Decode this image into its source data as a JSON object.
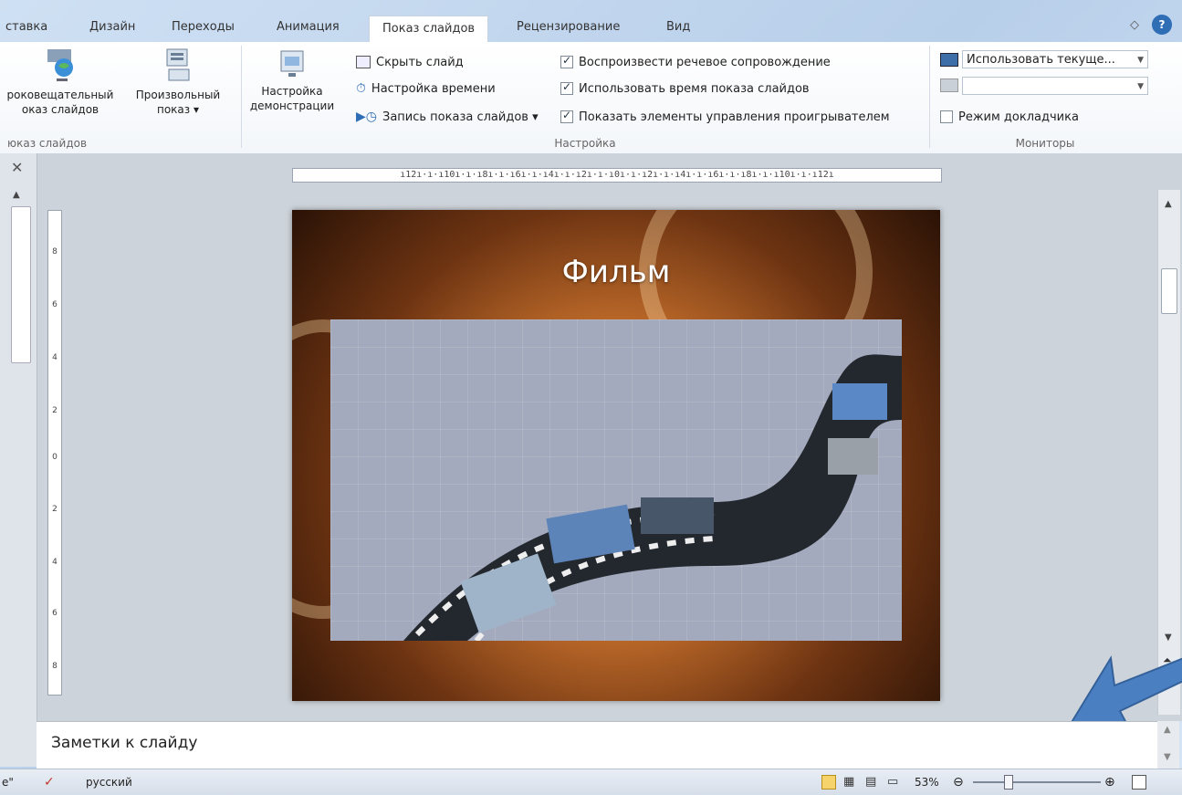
{
  "tabs": [
    {
      "label": "ставка"
    },
    {
      "label": "Дизайн"
    },
    {
      "label": "Переходы"
    },
    {
      "label": "Анимация"
    },
    {
      "label": "Показ слайдов"
    },
    {
      "label": "Рецензирование"
    },
    {
      "label": "Вид"
    }
  ],
  "ribbon": {
    "start_group": {
      "broadcast_line1": "роковещательный",
      "broadcast_line2": "оказ слайдов",
      "custom_line1": "Произвольный",
      "custom_line2": "показ ▾",
      "label": "юказ слайдов"
    },
    "setup_group": {
      "setup_line1": "Настройка",
      "setup_line2": "демонстрации",
      "hide_slide": "Скрыть слайд",
      "rehearse": "Настройка времени",
      "record": "Запись показа слайдов ▾",
      "play_narrations": "Воспроизвести речевое сопровождение",
      "use_timings": "Использовать время показа слайдов",
      "show_media_controls": "Показать элементы управления проигрывателем",
      "label": "Настройка"
    },
    "monitors_group": {
      "monitor_combo": "Использовать текуще...",
      "resolution_combo": "",
      "presenter_view": "Режим докладчика",
      "label": "Мониторы"
    }
  },
  "ruler": {
    "horizontal": "ı12ı·ı·ı10ı·ı·ı8ı·ı·ı6ı·ı·ı4ı·ı·ı2ı·ı·ı0ı·ı·ı2ı·ı·ı4ı·ı·ı6ı·ı·ı8ı·ı·ı10ı·ı·ı12ı",
    "vertical_ticks": [
      "8",
      "6",
      "4",
      "2",
      "0",
      "2",
      "4",
      "6",
      "8"
    ]
  },
  "slide": {
    "title": "Фильм"
  },
  "notes": {
    "placeholder": "Заметки к слайду"
  },
  "status": {
    "left_fragment": "e\"",
    "language": "русский",
    "zoom": "53%"
  },
  "colors": {
    "accent": "#4a7fc1",
    "ribbon_bg": "#ffffff",
    "workspace": "#cdd3da"
  }
}
